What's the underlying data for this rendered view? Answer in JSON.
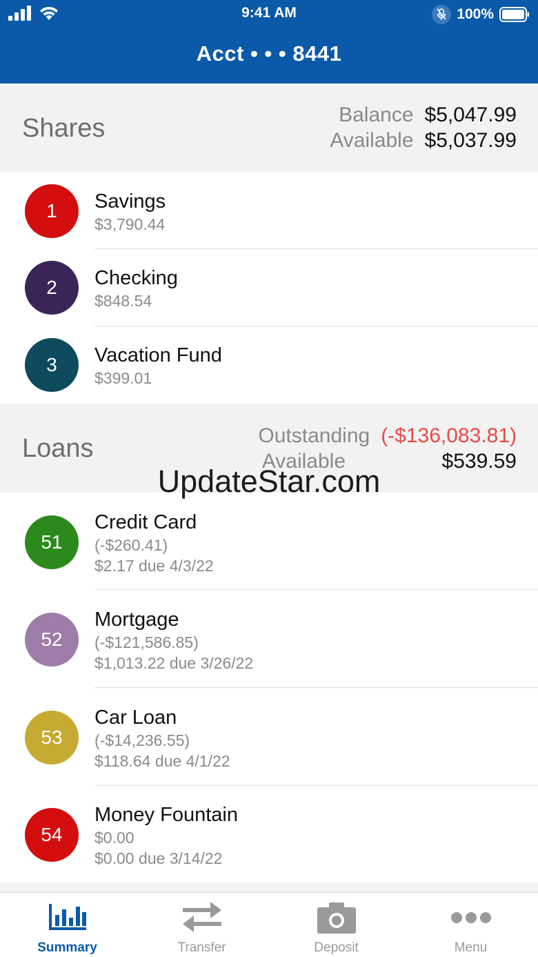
{
  "status_bar": {
    "time": "9:41 AM",
    "battery": "100%"
  },
  "header": {
    "title": "Acct • • • 8441"
  },
  "shares": {
    "title": "Shares",
    "balance_label": "Balance",
    "balance_value": "$5,047.99",
    "available_label": "Available",
    "available_value": "$5,037.99",
    "items": [
      {
        "number": "1",
        "name": "Savings",
        "amount": "$3,790.44",
        "color": "#d40e0e"
      },
      {
        "number": "2",
        "name": "Checking",
        "amount": "$848.54",
        "color": "#3b2458"
      },
      {
        "number": "3",
        "name": "Vacation Fund",
        "amount": "$399.01",
        "color": "#0d4a5e"
      }
    ]
  },
  "loans": {
    "title": "Loans",
    "outstanding_label": "Outstanding",
    "outstanding_value": "(-$136,083.81)",
    "available_label": "Available",
    "available_value": "$539.59",
    "items": [
      {
        "number": "51",
        "name": "Credit Card",
        "amount": "(-$260.41)",
        "due": "$2.17 due 4/3/22",
        "color": "#2c8a1d"
      },
      {
        "number": "52",
        "name": "Mortgage",
        "amount": "(-$121,586.85)",
        "due": "$1,013.22 due 3/26/22",
        "color": "#9e7ca8"
      },
      {
        "number": "53",
        "name": "Car Loan",
        "amount": "(-$14,236.55)",
        "due": "$118.64 due 4/1/22",
        "color": "#c7aa32"
      },
      {
        "number": "54",
        "name": "Money Fountain",
        "amount": "$0.00",
        "due": "$0.00 due 3/14/22",
        "color": "#d40e0e"
      }
    ]
  },
  "watermark": "UpdateStar.com",
  "tabs": [
    {
      "label": "Summary",
      "icon": "bar-chart-icon",
      "active": true
    },
    {
      "label": "Transfer",
      "icon": "transfer-arrows-icon",
      "active": false
    },
    {
      "label": "Deposit",
      "icon": "camera-icon",
      "active": false
    },
    {
      "label": "Menu",
      "icon": "more-dots-icon",
      "active": false
    }
  ],
  "colors": {
    "brand": "#0a5aa9",
    "negative": "#e84a47",
    "section_bg": "#f2f2f2"
  }
}
